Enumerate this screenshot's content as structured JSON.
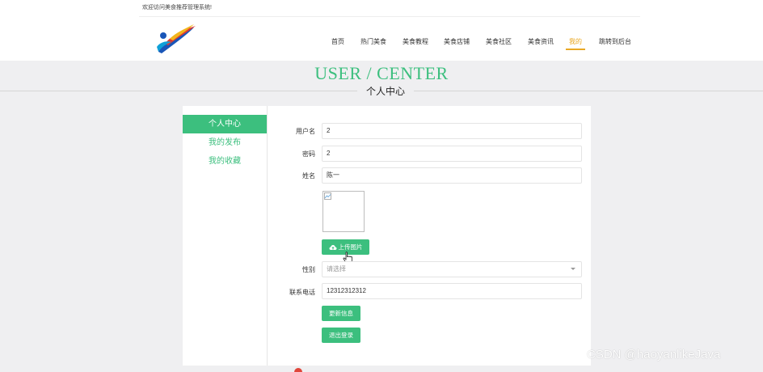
{
  "header": {
    "welcome": "欢迎访问美食推荐管理系统!",
    "logo_icon": "app-logo",
    "nav": [
      {
        "label": "首页"
      },
      {
        "label": "热门美食"
      },
      {
        "label": "美食教程"
      },
      {
        "label": "美食店铺"
      },
      {
        "label": "美食社区"
      },
      {
        "label": "美食资讯"
      },
      {
        "label": "我的",
        "active": true
      },
      {
        "label": "跳转到后台"
      }
    ]
  },
  "banner": {
    "title_en": "USER / CENTER",
    "title_cn": "个人中心"
  },
  "sidebar": {
    "items": [
      {
        "label": "个人中心",
        "active": true
      },
      {
        "label": "我的发布"
      },
      {
        "label": "我的收藏"
      }
    ]
  },
  "form": {
    "username": {
      "label": "用户名",
      "value": "2"
    },
    "password": {
      "label": "密码",
      "value": "2"
    },
    "name": {
      "label": "姓名",
      "value": "陈一"
    },
    "upload_button": "上传图片",
    "gender": {
      "label": "性别",
      "placeholder": "请选择"
    },
    "phone": {
      "label": "联系电话",
      "value": "12312312312"
    },
    "update_button": "更新信息",
    "logout_button": "退出登录"
  },
  "watermark": "CSDN @haoyanlikeJava",
  "colors": {
    "accent": "#3cbf7e",
    "nav_active": "#e9a825",
    "band": "#efeff1"
  }
}
